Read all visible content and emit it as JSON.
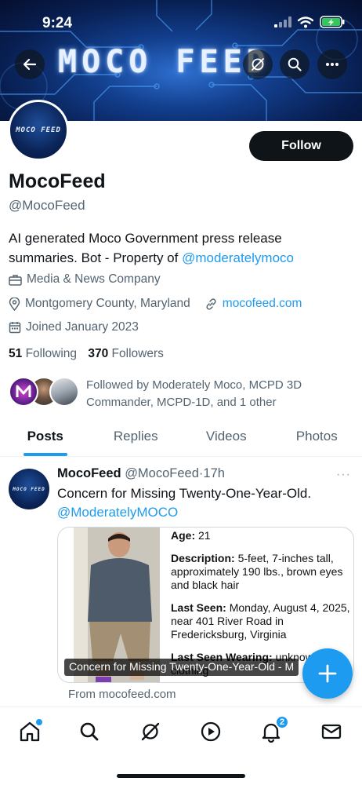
{
  "status_bar": {
    "time": "9:24"
  },
  "banner": {
    "title": "MOCO FEED"
  },
  "avatar": {
    "text": "MOCO FEED"
  },
  "profile": {
    "follow_label": "Follow",
    "display_name": "MocoFeed",
    "handle": "@MocoFeed",
    "bio_text": "AI generated Moco Government press release summaries. Bot - Property of ",
    "bio_link": "@moderatelymoco",
    "category": "Media & News Company",
    "location": "Montgomery County, Maryland",
    "website": "mocofeed.com",
    "joined": "Joined January 2023",
    "following_count": "51",
    "following_label": "Following",
    "followers_count": "370",
    "followers_label": "Followers",
    "followed_by": "Followed by Moderately Moco, MCPD 3D Commander, MCPD-1D, and 1 other"
  },
  "tabs": [
    {
      "label": "Posts",
      "active": true
    },
    {
      "label": "Replies",
      "active": false
    },
    {
      "label": "Videos",
      "active": false
    },
    {
      "label": "Photos",
      "active": false
    }
  ],
  "tweet": {
    "author": "MocoFeed",
    "handle": "@MocoFeed",
    "sep": "·",
    "time": "17h",
    "more": "···",
    "text": "Concern for Missing Twenty-One-Year-Old.",
    "mention": "@ModeratelyMOCO",
    "card": {
      "age_label": "Age:",
      "age_value": "21",
      "desc_label": "Description:",
      "desc_value": "5-feet, 7-inches tall, approximately 190 lbs., brown eyes and black hair",
      "seen_label": "Last Seen:",
      "seen_value": "Monday, August 4, 2025, near 401 River Road in Fredericksburg, Virginia",
      "wearing_label": "Last Seen Wearing:",
      "wearing_value": "unknown clothing",
      "caption": "Concern for Missing Twenty-One-Year-Old - M"
    },
    "source": "From mocofeed.com"
  },
  "bottom_nav": {
    "notifications_badge": "2"
  },
  "colors": {
    "accent": "#1d9bf0",
    "text": "#0f1419",
    "muted": "#536471"
  }
}
